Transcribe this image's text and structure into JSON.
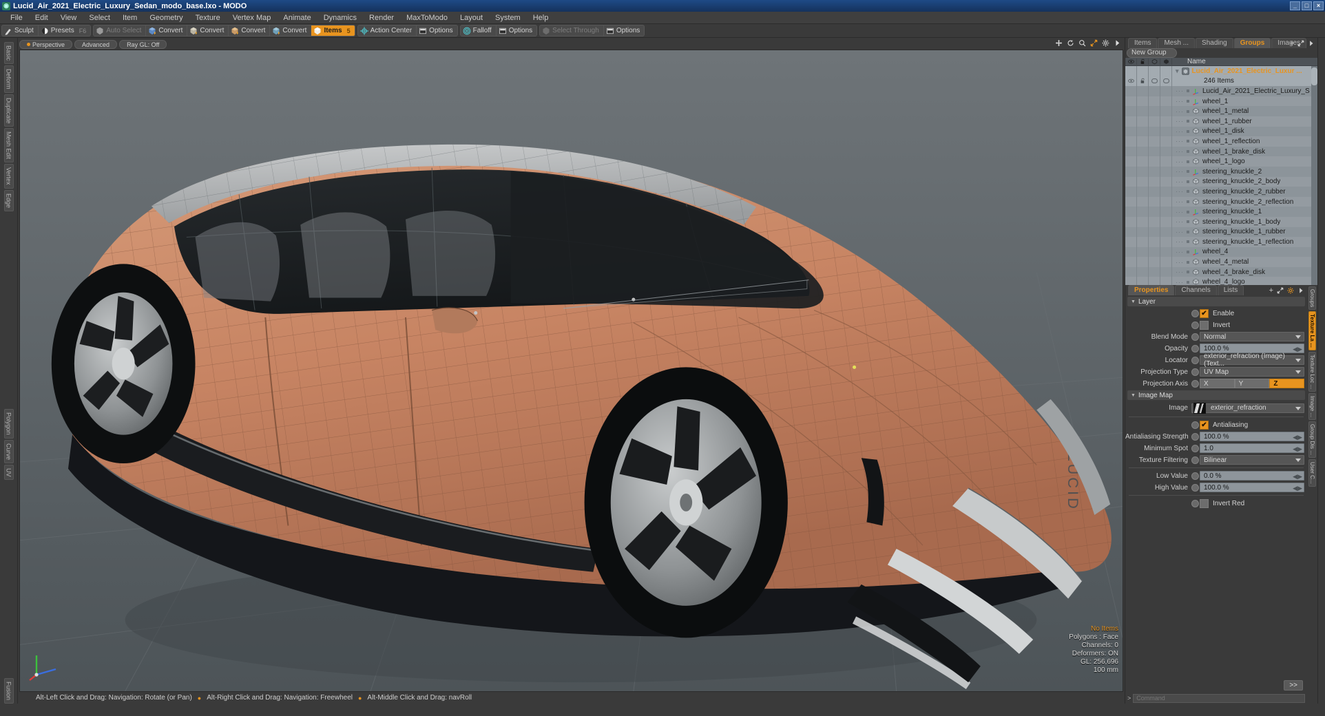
{
  "window": {
    "title": "Lucid_Air_2021_Electric_Luxury_Sedan_modo_base.lxo - MODO",
    "app_icon": "modo-icon",
    "minimize": "_",
    "maximize": "□",
    "close": "×"
  },
  "menubar": {
    "items": [
      "File",
      "Edit",
      "View",
      "Select",
      "Item",
      "Geometry",
      "Texture",
      "Vertex Map",
      "Animate",
      "Dynamics",
      "Render",
      "MaxToModo",
      "Layout",
      "System",
      "Help"
    ]
  },
  "toolbar": {
    "groups": [
      {
        "buttons": [
          {
            "label": "Sculpt",
            "icon": "brush-icon",
            "state": "normal",
            "shortcut": ""
          },
          {
            "label": "Presets",
            "icon": "sphere-icon",
            "state": "normal",
            "shortcut": "F6"
          }
        ]
      },
      {
        "buttons": [
          {
            "label": "Auto Select",
            "icon": "cube-grey-icon",
            "state": "disabled",
            "shortcut": ""
          },
          {
            "label": "Convert",
            "icon": "cube-blue-icon",
            "state": "normal",
            "shortcut": ""
          },
          {
            "label": "Convert",
            "icon": "cube-yellow-icon",
            "state": "normal",
            "shortcut": ""
          },
          {
            "label": "Convert",
            "icon": "cube-orange-icon",
            "state": "normal",
            "shortcut": ""
          },
          {
            "label": "Convert",
            "icon": "cube-teal-icon",
            "state": "normal",
            "shortcut": ""
          },
          {
            "label": "Items",
            "icon": "cube-items-icon",
            "state": "active",
            "shortcut": "5"
          }
        ]
      },
      {
        "buttons": [
          {
            "label": "Action Center",
            "icon": "action-center-icon",
            "state": "normal",
            "shortcut": ""
          },
          {
            "label": "Options",
            "icon": "options-icon",
            "state": "normal",
            "shortcut": ""
          }
        ]
      },
      {
        "buttons": [
          {
            "label": "Falloff",
            "icon": "falloff-icon",
            "state": "normal",
            "shortcut": ""
          },
          {
            "label": "Options",
            "icon": "options-icon",
            "state": "normal",
            "shortcut": ""
          }
        ]
      },
      {
        "buttons": [
          {
            "label": "Select Through",
            "icon": "select-through-icon",
            "state": "disabled",
            "shortcut": ""
          },
          {
            "label": "Options",
            "icon": "options-icon",
            "state": "normal",
            "shortcut": ""
          }
        ]
      }
    ]
  },
  "left_rail": {
    "tabs": [
      "Basic",
      "Deform",
      "Duplicate",
      "Mesh Edit",
      "Vertex",
      "Edge",
      "Polygon",
      "Curve",
      "UV",
      "Fusion"
    ]
  },
  "viewport": {
    "header": {
      "view_mode": "Perspective",
      "shading": "Advanced",
      "raygl": "Ray GL: Off"
    },
    "nav_icons": [
      "pan-icon",
      "rotate-icon",
      "zoom-icon",
      "fit-icon",
      "gear-icon",
      "chevron-right-icon"
    ],
    "info": {
      "selection": "No Items",
      "polygons": "Polygons : Face",
      "channels": "Channels: 0",
      "deformers": "Deformers: ON",
      "gl": "GL: 256,696",
      "scale": "100 mm"
    },
    "gizmo_axes": [
      "X",
      "Y",
      "Z"
    ]
  },
  "statusbar": {
    "hints": [
      "Alt-Left Click and Drag: Navigation: Rotate (or Pan)",
      "Alt-Right Click and Drag: Navigation: Freewheel",
      "Alt-Middle Click and Drag: navRoll"
    ]
  },
  "groups_panel": {
    "tabs": [
      {
        "label": "Items",
        "active": false
      },
      {
        "label": "Mesh ...",
        "active": false
      },
      {
        "label": "Shading",
        "active": false
      },
      {
        "label": "Groups",
        "active": true
      },
      {
        "label": "Images",
        "active": false
      }
    ],
    "tab_add": "+",
    "tab_icons": [
      "expand-icon",
      "chevron-right-icon"
    ],
    "new_group_button": "New Group",
    "column_headers": {
      "eye": "visibility-icon",
      "lock": "lock-icon",
      "shade": "shading-icon",
      "render": "render-icon",
      "name": "Name"
    },
    "root": {
      "name": "Lucid_Air_2021_Electric_Luxur ...",
      "count_label": "246 Items",
      "icon": "group-icon",
      "selected": true
    },
    "items": [
      {
        "name": "Lucid_Air_2021_Electric_Luxury_S ...",
        "icon": "locator-icon"
      },
      {
        "name": "wheel_1",
        "icon": "locator-icon"
      },
      {
        "name": "wheel_1_metal",
        "icon": "mesh-icon"
      },
      {
        "name": "wheel_1_rubber",
        "icon": "mesh-icon"
      },
      {
        "name": "wheel_1_disk",
        "icon": "mesh-icon"
      },
      {
        "name": "wheel_1_reflection",
        "icon": "mesh-icon"
      },
      {
        "name": "wheel_1_brake_disk",
        "icon": "mesh-icon"
      },
      {
        "name": "wheel_1_logo",
        "icon": "mesh-icon"
      },
      {
        "name": "steering_knuckle_2",
        "icon": "locator-icon"
      },
      {
        "name": "steering_knuckle_2_body",
        "icon": "mesh-icon"
      },
      {
        "name": "steering_knuckle_2_rubber",
        "icon": "mesh-icon"
      },
      {
        "name": "steering_knuckle_2_reflection",
        "icon": "mesh-icon"
      },
      {
        "name": "steering_knuckle_1",
        "icon": "locator-icon"
      },
      {
        "name": "steering_knuckle_1_body",
        "icon": "mesh-icon"
      },
      {
        "name": "steering_knuckle_1_rubber",
        "icon": "mesh-icon"
      },
      {
        "name": "steering_knuckle_1_reflection",
        "icon": "mesh-icon"
      },
      {
        "name": "wheel_4",
        "icon": "locator-icon"
      },
      {
        "name": "wheel_4_metal",
        "icon": "mesh-icon"
      },
      {
        "name": "wheel_4_brake_disk",
        "icon": "mesh-icon"
      },
      {
        "name": "wheel_4_logo",
        "icon": "mesh-icon"
      }
    ]
  },
  "properties_panel": {
    "tabs": [
      {
        "label": "Properties",
        "active": true
      },
      {
        "label": "Channels",
        "active": false
      },
      {
        "label": "Lists",
        "active": false
      }
    ],
    "tab_add": "+",
    "tab_icons": [
      "expand-icon",
      "gear-icon",
      "chevron-right-icon"
    ],
    "sections": [
      {
        "title": "Layer",
        "rows": [
          {
            "type": "checkbox",
            "label": "Enable",
            "checked": true
          },
          {
            "type": "checkbox",
            "label": "Invert",
            "checked": false
          },
          {
            "type": "dropdown",
            "label": "Blend Mode",
            "value": "Normal"
          },
          {
            "type": "numeric",
            "label": "Opacity",
            "value": "100.0 %"
          },
          {
            "type": "dropdown",
            "label": "Locator",
            "value": "exterior_refraction (Image) (Text..."
          },
          {
            "type": "dropdown",
            "label": "Projection Type",
            "value": "UV Map"
          },
          {
            "type": "axis",
            "label": "Projection Axis",
            "options": [
              "X",
              "Y",
              "Z"
            ],
            "selected": "Z"
          }
        ]
      },
      {
        "title": "Image Map",
        "rows": [
          {
            "type": "image",
            "label": "Image",
            "value": "exterior_refraction"
          },
          {
            "type": "checkbox",
            "label": "Antialiasing",
            "checked": true
          },
          {
            "type": "numeric",
            "label": "Antialiasing Strength",
            "value": "100.0 %"
          },
          {
            "type": "numeric",
            "label": "Minimum Spot",
            "value": "1.0"
          },
          {
            "type": "dropdown",
            "label": "Texture Filtering",
            "value": "Bilinear"
          },
          {
            "type": "numeric",
            "label": "Low Value",
            "value": "0.0 %"
          },
          {
            "type": "numeric",
            "label": "High Value",
            "value": "100.0 %"
          },
          {
            "type": "checkbox",
            "label": "Invert Red",
            "checked": false
          }
        ]
      }
    ],
    "more_button": ">>",
    "side_rail": [
      "Groups",
      "Texture La ...",
      "Texture Loc ...",
      "Image ...",
      "Group Dis ...",
      "User C..."
    ]
  },
  "command_bar": {
    "chevron": ">",
    "placeholder": "Command"
  },
  "colors": {
    "accent": "#e8941f",
    "title_bar": "#1e4a86",
    "panel_bg": "#3a3a3a",
    "list_bg": "#8c949a",
    "field_bg": "#8e959b",
    "car_body": "#c78463"
  }
}
